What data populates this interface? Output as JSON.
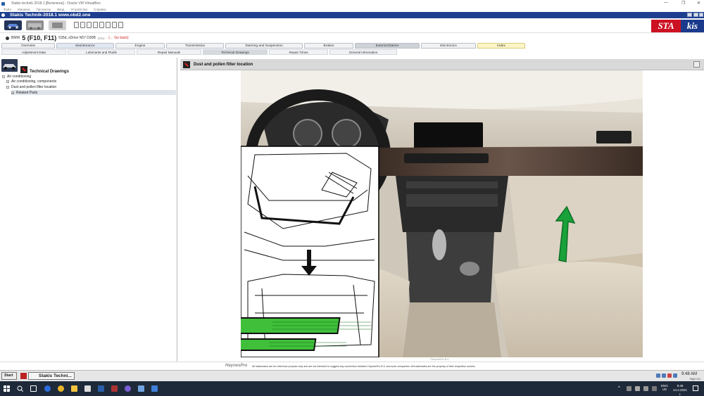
{
  "vbox": {
    "title": "Stakis technik 2018.1 [Включена] - Oracle VM VirtualBox",
    "menu": [
      "Файл",
      "Машина",
      "Просмотр",
      "Ввод",
      "Устройства",
      "Справка"
    ]
  },
  "app": {
    "title": "Stakis Technik-2018.1    www.obd2.one",
    "brand_left": "STA",
    "brand_right": "kis"
  },
  "vehicle": {
    "make": "BMW",
    "model": "5 (F10, F11)",
    "engine": "535d, xDrive N57 D30B",
    "year": "2011 -",
    "go_back": "(← Go back)"
  },
  "main_tabs": [
    "Overview",
    "Maintenance",
    "Engine",
    "Transmission",
    "Steering and Suspension",
    "Brakes",
    "Exterior/Interior",
    "Electronics",
    "Index"
  ],
  "sub_tabs": [
    "Adjustment Data",
    "Lubricants and Fluids",
    "Repair Manuals",
    "Technical Drawings",
    "Repair Times",
    "General Information"
  ],
  "left_panel": {
    "title": "Technical Drawings",
    "tree": [
      {
        "label": "Air conditioning",
        "level": 0
      },
      {
        "label": "Air conditioning, components",
        "level": 1
      },
      {
        "label": "Dust and pollen filter location",
        "level": 1
      },
      {
        "label": "Related Parts",
        "level": 2
      }
    ]
  },
  "right_panel": {
    "title": "Dust and pollen filter location",
    "figure_credit": "©HaynesPro B.V."
  },
  "footer": {
    "haynes_logo": "HaynesPro",
    "trademark": "All trademarks are for reference purpose only and are not intended to suggest any connection between HaynesPro B.V. and such companies. All trademarks are the property of their respective owners"
  },
  "vb_status": {
    "start": "Start",
    "task": "Stakis Techni...",
    "time": "9:48 AM",
    "right_ctrl": "Right Ctrl"
  },
  "taskbar": {
    "lang": "ENG",
    "region": "US",
    "time": "9:48",
    "date": "14.4.2021 г."
  },
  "colors": {
    "title_bar": "#1e3f8f",
    "brand_red": "#cc1122",
    "brand_blue": "#1b3a8c",
    "arrow_green": "#19a23a",
    "filter_green": "#3fbf3a"
  },
  "icons": {
    "tree_expand": "plus-box-icon",
    "tree_collapse": "minus-box-icon",
    "print": "print-icon"
  }
}
